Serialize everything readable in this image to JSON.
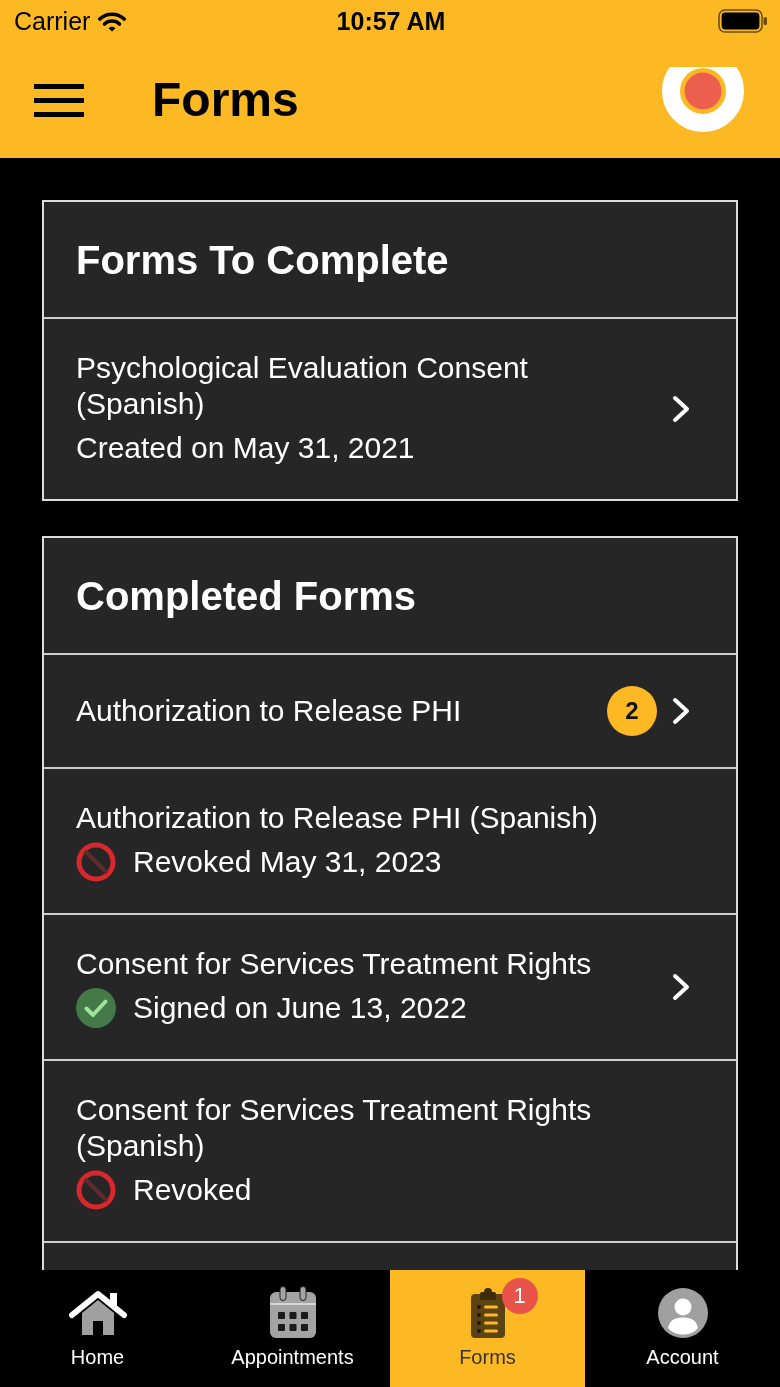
{
  "status_bar": {
    "carrier": "Carrier",
    "time": "10:57 AM"
  },
  "header": {
    "title": "Forms"
  },
  "sections": [
    {
      "title": "Forms To Complete",
      "items": [
        {
          "title": "Psychological Evaluation Consent (Spanish)",
          "status": {
            "kind": "created",
            "text": "Created on May 31, 2021"
          },
          "chevron": true
        }
      ]
    },
    {
      "title": "Completed Forms",
      "items": [
        {
          "title": "Authorization to Release PHI",
          "badge": "2",
          "chevron": true
        },
        {
          "title": "Authorization to Release PHI (Spanish)",
          "status": {
            "kind": "revoked",
            "text": "Revoked May 31, 2023"
          },
          "chevron": false
        },
        {
          "title": "Consent for Services Treatment Rights",
          "status": {
            "kind": "signed",
            "text": "Signed on June 13, 2022"
          },
          "chevron": true
        },
        {
          "title": "Consent for Services Treatment Rights (Spanish)",
          "status": {
            "kind": "revoked",
            "text": "Revoked"
          },
          "chevron": false
        }
      ]
    }
  ],
  "tab_bar": {
    "tabs": [
      {
        "label": "Home",
        "kind": "home",
        "selected": false
      },
      {
        "label": "Appointments",
        "kind": "calendar",
        "selected": false
      },
      {
        "label": "Forms",
        "kind": "forms",
        "selected": true,
        "badge": "1"
      },
      {
        "label": "Account",
        "kind": "account",
        "selected": false
      }
    ]
  }
}
